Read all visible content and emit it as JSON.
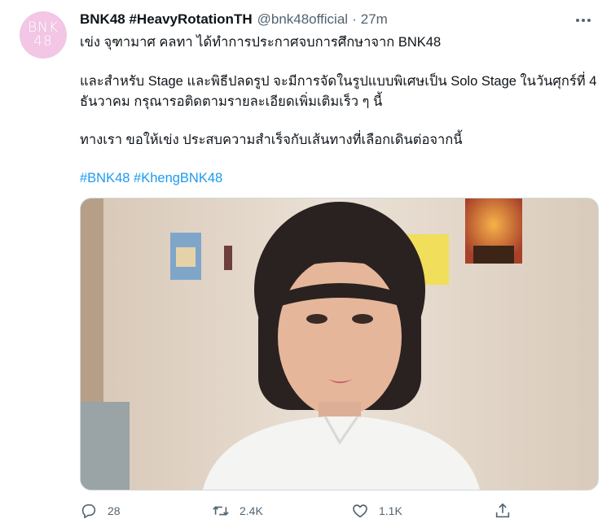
{
  "tweet": {
    "avatar_text_line1": "BNK",
    "avatar_text_line2": "48",
    "display_name": "BNK48 #HeavyRotationTH",
    "handle": "@bnk48official",
    "separator": "·",
    "time": "27m",
    "text": {
      "line1": "เข่ง จุฑามาศ คลทา ได้ทำการประกาศจบการศึกษาจาก BNK48",
      "line2": "และสำหรับ Stage และพิธีปลดรูป จะมีการจัดในรูปแบบพิเศษเป็น Solo Stage ในวันศุกร์ที่ 4",
      "line3": "ธันวาคม กรุณารอติดตามรายละเอียดเพิ่มเติมเร็ว ๆ นี้",
      "line4": "ทางเรา ขอให้เข่ง ประสบความสำเร็จกับเส้นทางที่เลือกเดินต่อจากนี้",
      "hashtags": "#BNK48 #KhengBNK48"
    },
    "actions": {
      "reply_count": "28",
      "retweet_count": "2.4K",
      "like_count": "1.1K"
    }
  },
  "icons": {
    "more": "more-icon",
    "reply": "reply-icon",
    "retweet": "retweet-icon",
    "like": "like-icon",
    "share": "share-icon"
  },
  "colors": {
    "text": "#0f1419",
    "secondary": "#536471",
    "link": "#1d9bf0",
    "avatar_bg": "#f2c6e4"
  }
}
